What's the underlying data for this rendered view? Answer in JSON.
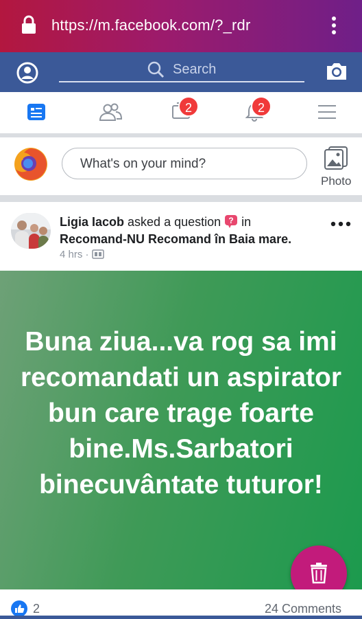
{
  "browser": {
    "url": "https://m.facebook.com/?_rdr"
  },
  "header": {
    "search_placeholder": "Search"
  },
  "tabs": [
    {
      "name": "news-feed",
      "badge": ""
    },
    {
      "name": "friend-requests",
      "badge": ""
    },
    {
      "name": "messages",
      "badge": "2"
    },
    {
      "name": "notifications",
      "badge": "2"
    },
    {
      "name": "menu",
      "badge": ""
    }
  ],
  "composer": {
    "placeholder": "What's on your mind?",
    "photo_label": "Photo"
  },
  "post": {
    "author": "Ligia Iacob",
    "action": " asked a question ",
    "in_word": " in",
    "group": "Recomand-NU Recomand în Baia mare.",
    "time": "4 hrs",
    "separator": "·",
    "body": "Buna ziua...va rog sa imi recomandati un aspirator bun care trage foarte bine.Ms.Sarbatori binecuvântate tuturor!",
    "likes": "2",
    "comments": "24 Comments"
  },
  "colors": {
    "fb_blue": "#3b5998",
    "post_green": "#2e9a55",
    "fab": "#c21b7b",
    "badge": "#f03a3a"
  }
}
